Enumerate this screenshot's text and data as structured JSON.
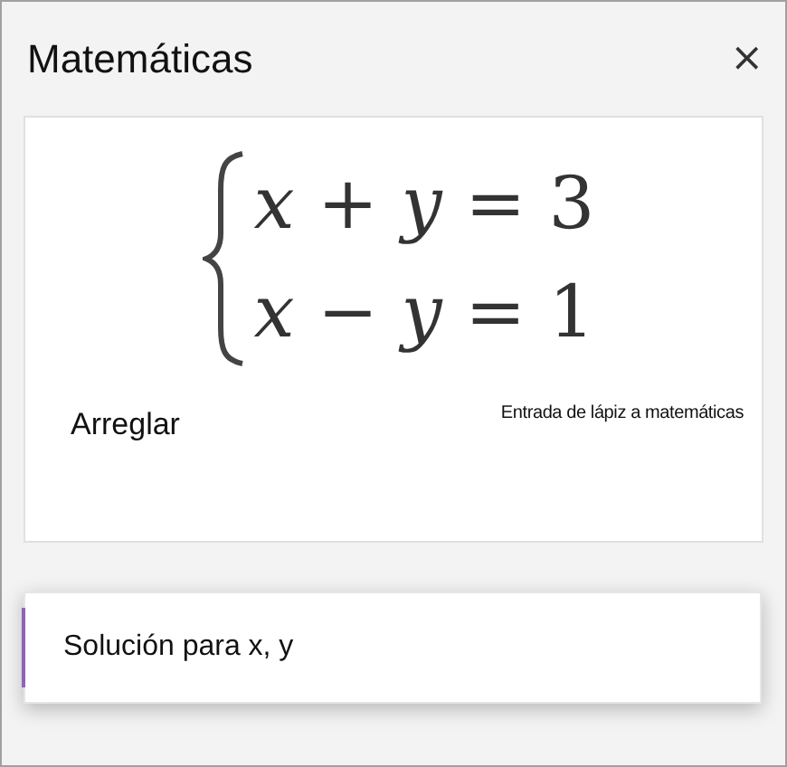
{
  "panel": {
    "title": "Matemáticas",
    "close": "×"
  },
  "equation_card": {
    "equations": [
      "*x* + *y* = 3",
      "*x* − *y* = 1"
    ],
    "fix_button": "Arreglar",
    "ink_link": "Entrada de lápiz a matemáticas"
  },
  "action_dropdown": {
    "value": "Solución para x, y"
  }
}
